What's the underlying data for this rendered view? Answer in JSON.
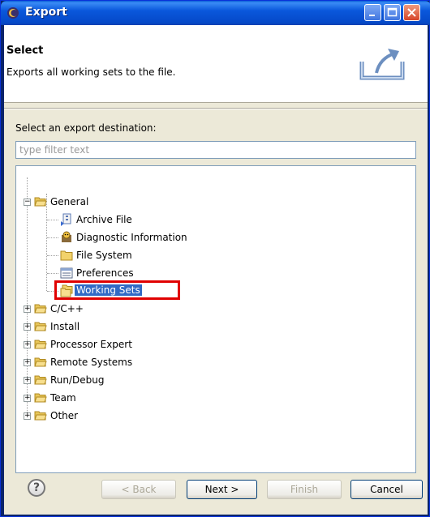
{
  "window": {
    "title": "Export"
  },
  "header": {
    "title": "Select",
    "description": "Exports all working sets to the file."
  },
  "destination": {
    "label": "Select an export destination:",
    "filter_placeholder": "type filter text"
  },
  "tree": {
    "general": {
      "label": "General",
      "children": [
        {
          "label": "Archive File",
          "icon": "archive-file-icon"
        },
        {
          "label": "Diagnostic Information",
          "icon": "diagnostic-icon"
        },
        {
          "label": "File System",
          "icon": "folder-icon"
        },
        {
          "label": "Preferences",
          "icon": "preferences-icon"
        },
        {
          "label": "Working Sets",
          "icon": "working-sets-icon",
          "selected": true
        }
      ]
    },
    "categories": [
      "C/C++",
      "Install",
      "Processor Expert",
      "Remote Systems",
      "Run/Debug",
      "Team",
      "Other"
    ]
  },
  "buttons": {
    "back": "< Back",
    "next": "Next >",
    "finish": "Finish",
    "cancel": "Cancel"
  },
  "colors": {
    "selection": "#316ac5",
    "highlight": "#e00000"
  }
}
